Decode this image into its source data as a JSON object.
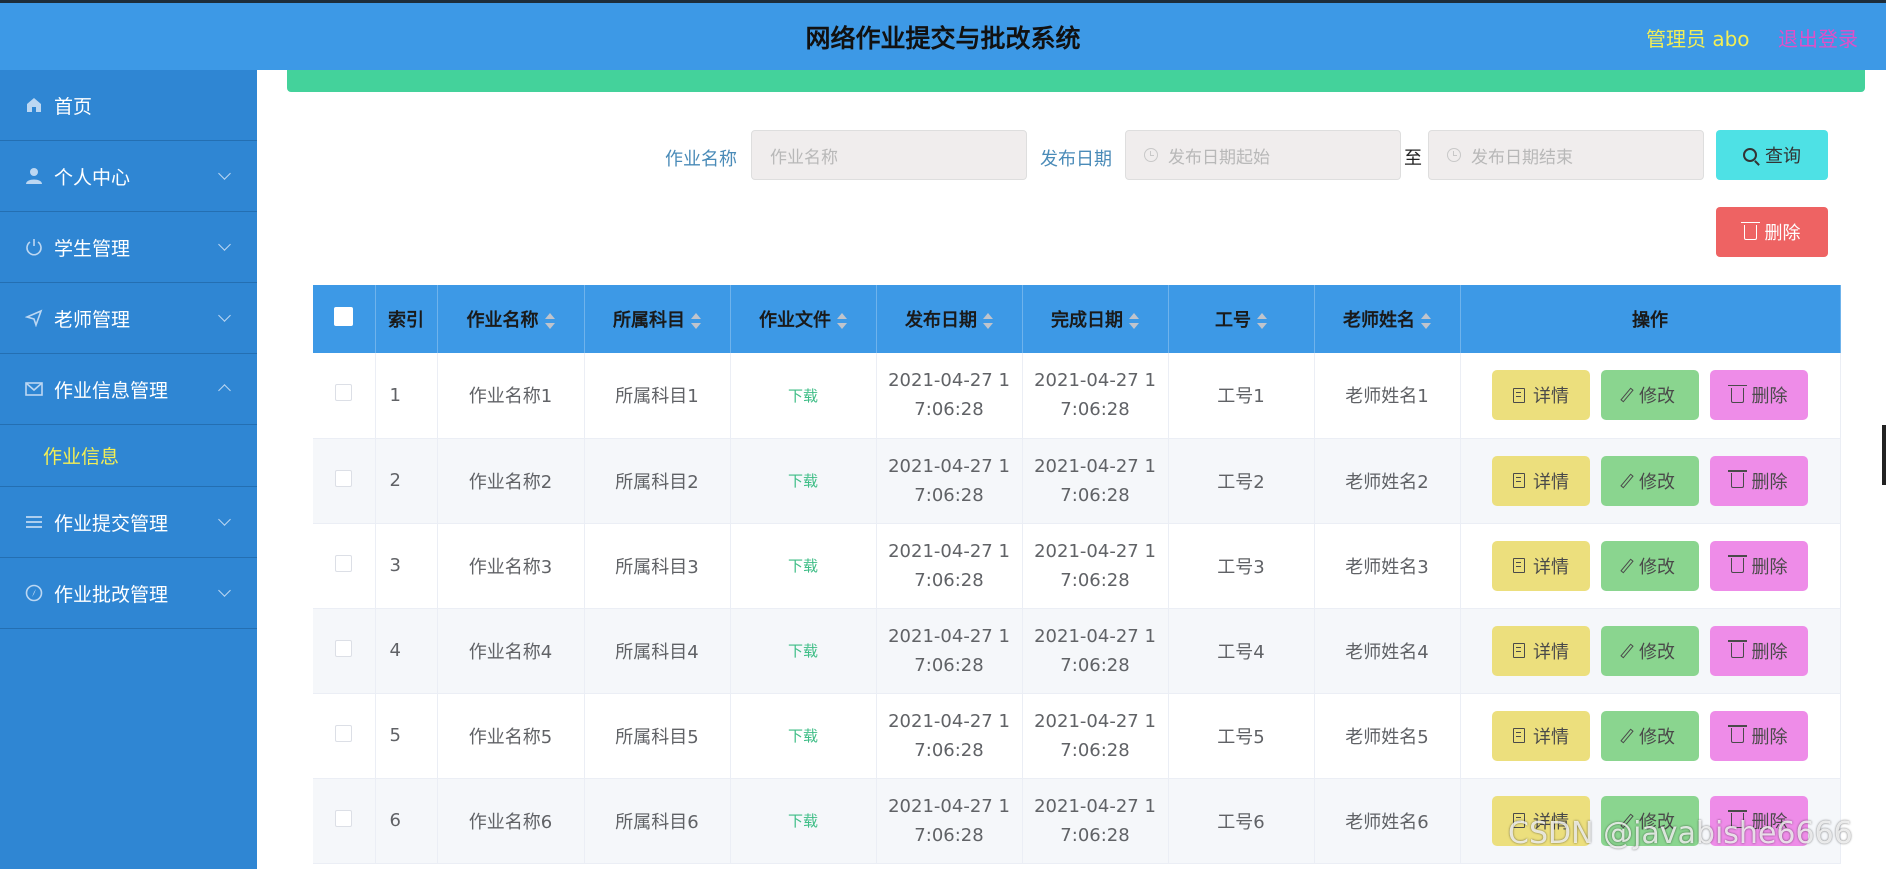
{
  "header": {
    "title": "网络作业提交与批改系统",
    "user": "管理员 abo",
    "logout": "退出登录"
  },
  "sidebar": {
    "items": [
      {
        "label": "首页",
        "icon": "home-icon"
      },
      {
        "label": "个人中心",
        "icon": "user-icon"
      },
      {
        "label": "学生管理",
        "icon": "power-icon"
      },
      {
        "label": "老师管理",
        "icon": "send-icon"
      },
      {
        "label": "作业信息管理",
        "icon": "mail-icon",
        "expanded": true
      },
      {
        "label": "作业信息",
        "sub": true
      },
      {
        "label": "作业提交管理",
        "icon": "list-icon"
      },
      {
        "label": "作业批改管理",
        "icon": "compass-icon"
      }
    ]
  },
  "search": {
    "name_label": "作业名称",
    "name_placeholder": "作业名称",
    "date_label": "发布日期",
    "date_start_placeholder": "发布日期起始",
    "date_to": "至",
    "date_end_placeholder": "发布日期结束",
    "query_label": "查询",
    "bulk_delete_label": "删除"
  },
  "table": {
    "columns": [
      "索引",
      "作业名称",
      "所属科目",
      "作业文件",
      "发布日期",
      "完成日期",
      "工号",
      "老师姓名",
      "操作"
    ],
    "rows": [
      {
        "index": "1",
        "name": "作业名称1",
        "subject": "所属科目1",
        "file": "下载",
        "pub1": "2021-04-27 1",
        "pub2": "7:06:28",
        "done1": "2021-04-27 1",
        "done2": "7:06:28",
        "empno": "工号1",
        "teacher": "老师姓名1"
      },
      {
        "index": "2",
        "name": "作业名称2",
        "subject": "所属科目2",
        "file": "下载",
        "pub1": "2021-04-27 1",
        "pub2": "7:06:28",
        "done1": "2021-04-27 1",
        "done2": "7:06:28",
        "empno": "工号2",
        "teacher": "老师姓名2"
      },
      {
        "index": "3",
        "name": "作业名称3",
        "subject": "所属科目3",
        "file": "下载",
        "pub1": "2021-04-27 1",
        "pub2": "7:06:28",
        "done1": "2021-04-27 1",
        "done2": "7:06:28",
        "empno": "工号3",
        "teacher": "老师姓名3"
      },
      {
        "index": "4",
        "name": "作业名称4",
        "subject": "所属科目4",
        "file": "下载",
        "pub1": "2021-04-27 1",
        "pub2": "7:06:28",
        "done1": "2021-04-27 1",
        "done2": "7:06:28",
        "empno": "工号4",
        "teacher": "老师姓名4"
      },
      {
        "index": "5",
        "name": "作业名称5",
        "subject": "所属科目5",
        "file": "下载",
        "pub1": "2021-04-27 1",
        "pub2": "7:06:28",
        "done1": "2021-04-27 1",
        "done2": "7:06:28",
        "empno": "工号5",
        "teacher": "老师姓名5"
      },
      {
        "index": "6",
        "name": "作业名称6",
        "subject": "所属科目6",
        "file": "下载",
        "pub1": "2021-04-27 1",
        "pub2": "7:06:28",
        "done1": "2021-04-27 1",
        "done2": "7:06:28",
        "empno": "工号6",
        "teacher": "老师姓名6"
      }
    ],
    "actions": {
      "detail": "详情",
      "edit": "修改",
      "delete": "删除"
    }
  },
  "watermark": "CSDN @javabishe6666",
  "colors": {
    "header_bg": "#3d99e6",
    "sidebar_bg": "#2f86d3",
    "accent_yellow": "#f3ee55",
    "green_bar": "#44d29b",
    "query_btn": "#4ee1e5",
    "delete_btn": "#ee6363",
    "detail_btn": "#ecdf7d",
    "edit_btn": "#8ad58f",
    "row_delete_btn": "#ee8ce8"
  }
}
